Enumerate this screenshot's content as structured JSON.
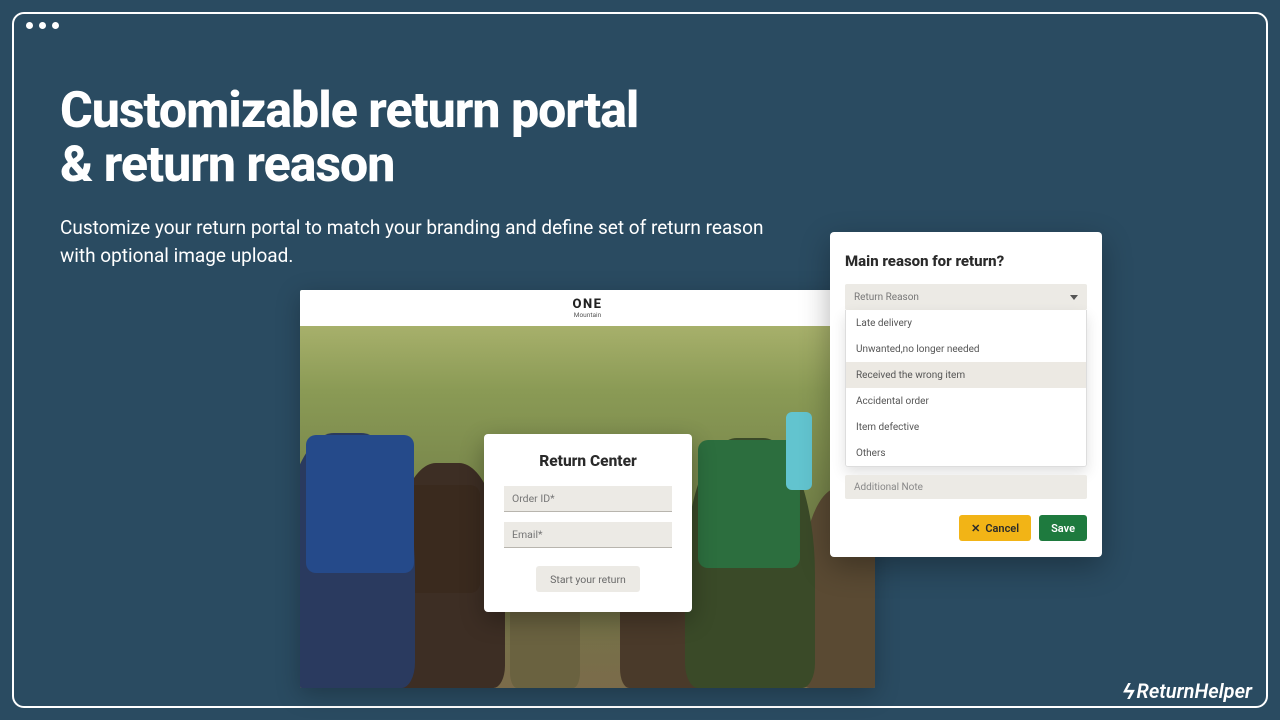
{
  "hero": {
    "title_line1": "Customizable return portal",
    "title_line2": "& return reason",
    "subtitle": "Customize your return portal to match your branding and define set of return reason with optional image upload."
  },
  "portal": {
    "brand": "ONE",
    "tagline": "Mountain",
    "card_title": "Return Center",
    "order_placeholder": "Order ID*",
    "email_placeholder": "Email*",
    "start_button": "Start your return"
  },
  "modal": {
    "title": "Main reason for return?",
    "select_placeholder": "Return Reason",
    "options": {
      "0": "Late delivery",
      "1": "Unwanted,no longer needed",
      "2": "Received the wrong item",
      "3": "Accidental order",
      "4": "Item defective",
      "5": "Others"
    },
    "note_placeholder": "Additional Note",
    "cancel": "Cancel",
    "save": "Save"
  },
  "footer": {
    "logo_text": "ReturnHelper"
  },
  "colors": {
    "bg": "#2a4b61",
    "accent_yellow": "#f2b416",
    "accent_green": "#1e7a3e"
  }
}
